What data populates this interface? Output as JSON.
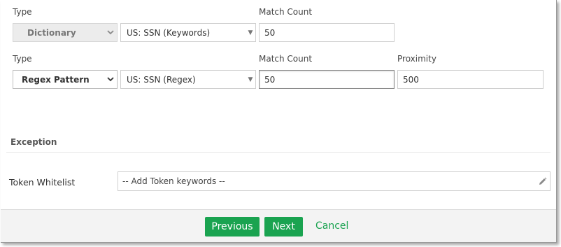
{
  "row1": {
    "type_label": "Type",
    "type_value": "Dictionary",
    "dictionary_value": "US: SSN (Keywords)",
    "match_count_label": "Match Count",
    "match_count_value": "50"
  },
  "row2": {
    "type_label": "Type",
    "type_value": "Regex Pattern",
    "pattern_value": "US: SSN (Regex)",
    "match_count_label": "Match Count",
    "match_count_value": "50",
    "proximity_label": "Proximity",
    "proximity_value": "500"
  },
  "exception": {
    "title": "Exception",
    "token_whitelist_label": "Token Whitelist",
    "token_placeholder": "-- Add Token keywords --"
  },
  "footer": {
    "previous_label": "Previous",
    "next_label": "Next",
    "cancel_label": "Cancel"
  },
  "icons": {
    "chevron": "chevron-down-icon",
    "caret": "caret-down-icon",
    "edit": "pencil-icon"
  },
  "colors": {
    "accent": "#1aa350",
    "footer_bg": "#f3f3f3"
  }
}
